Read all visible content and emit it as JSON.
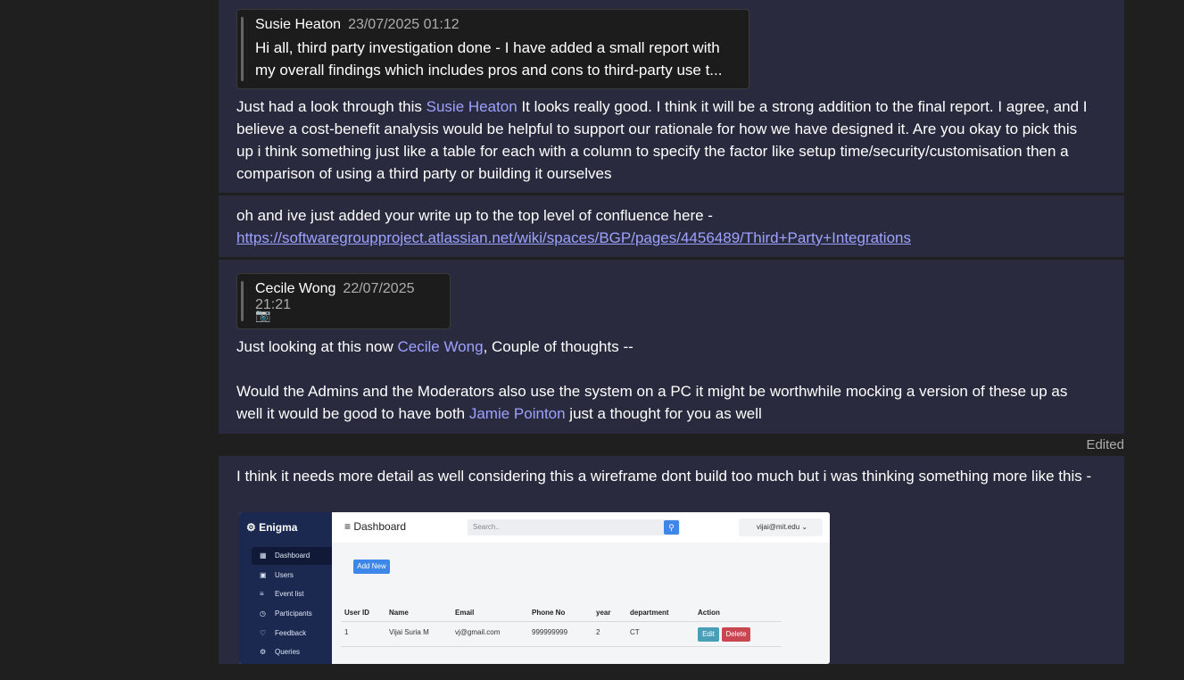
{
  "messages": [
    {
      "quote": {
        "author": "Susie Heaton",
        "time": "23/07/2025 01:12",
        "body": "Hi all, third party investigation done - I have added a small report with my overall findings which includes pros and cons to third-party use t..."
      },
      "text_pre": "Just had a look through this ",
      "mention": "Susie Heaton",
      "text_post": " It looks really good. I think it will be a strong addition to the final report. I agree, and I believe a cost-benefit analysis would be helpful to support our rationale for how we have designed it. Are you okay to pick this up i think something just like a table for each with a column to specify the factor like setup time/security/customisation then a comparison of using a third party or building it ourselves"
    },
    {
      "text": "oh and ive just added your write up to the top level of confluence here -",
      "link": "https://softwaregroupproject.atlassian.net/wiki/spaces/BGP/pages/4456489/Third+Party+Integrations"
    },
    {
      "quote": {
        "author": "Cecile Wong",
        "time": "22/07/2025 21:21",
        "attachment_icon": "camera-icon"
      },
      "text_pre": "Just looking at this now ",
      "mention": "Cecile Wong",
      "text_post": ", Couple of thoughts --",
      "text2_pre": "Would the Admins and the Moderators also use the system on a PC it might be worthwhile mocking a version of these up as well it would be good to have both ",
      "mention2": "Jamie Pointon",
      "text2_post": " just a thought for you as well",
      "edited": "Edited"
    },
    {
      "text": "I think it needs more detail as well considering this a wireframe dont build too much but i was thinking something more like this -"
    }
  ],
  "screenshot": {
    "logo": "Enigma",
    "nav": [
      "Dashboard",
      "Users",
      "Event list",
      "Participants",
      "Feedback",
      "Queries"
    ],
    "title": "Dashboard",
    "search_placeholder": "Search..",
    "user": "vijai@mit.edu",
    "add_new": "Add New",
    "columns": [
      "User ID",
      "Name",
      "Email",
      "Phone No",
      "year",
      "department",
      "Action"
    ],
    "row": [
      "1",
      "Vijai Suria M",
      "vj@gmail.com",
      "999999999",
      "2",
      "CT"
    ],
    "edit": "Edit",
    "delete": "Delete"
  },
  "colors": {
    "mention": "#9ea2ff",
    "message_bg": "#292a3e",
    "page_bg": "#1f1f1f"
  }
}
